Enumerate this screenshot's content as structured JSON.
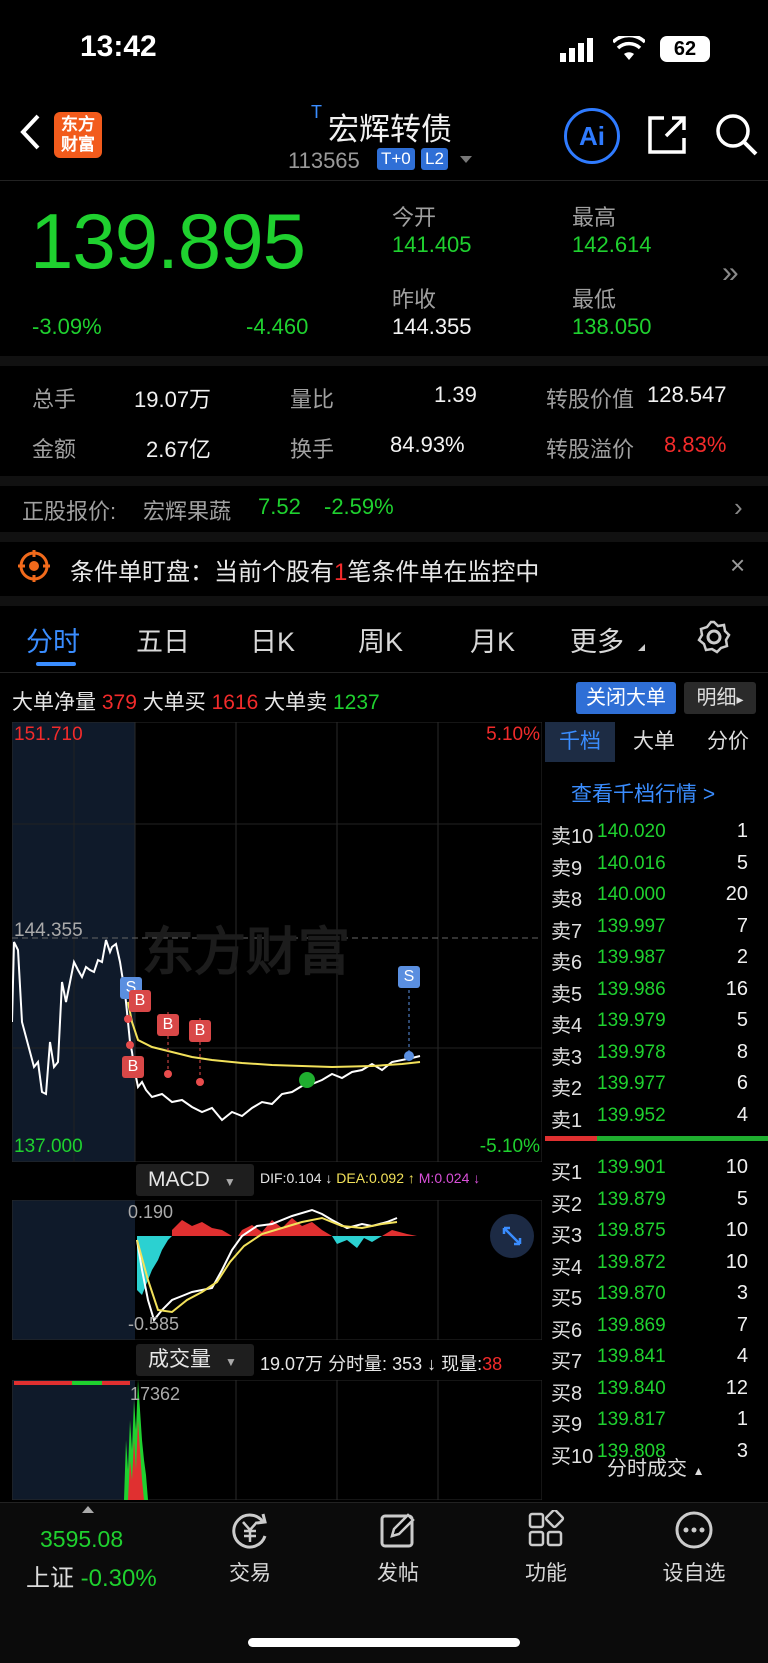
{
  "status_bar": {
    "time": "13:42",
    "battery": "62"
  },
  "header": {
    "logo_text": "东方\n财富",
    "prefix_mark": "T",
    "title": "宏辉转债",
    "code": "113565",
    "badge_t0": "T+0",
    "badge_l2": "L2",
    "ai_label": "Ai"
  },
  "quote": {
    "price": "139.895",
    "change_pct": "-3.09%",
    "change": "-4.460",
    "open_label": "今开",
    "open": "141.405",
    "high_label": "最高",
    "high": "142.614",
    "prev_close_label": "昨收",
    "prev_close": "144.355",
    "low_label": "最低",
    "low": "138.050"
  },
  "stats": {
    "volume_label": "总手",
    "volume": "19.07万",
    "ratio_label": "量比",
    "ratio": "1.39",
    "conv_value_label": "转股价值",
    "conv_value": "128.547",
    "amount_label": "金额",
    "amount": "2.67亿",
    "turnover_label": "换手",
    "turnover": "84.93%",
    "premium_label": "转股溢价",
    "premium": "8.83%"
  },
  "underlying": {
    "label": "正股报价:",
    "name": "宏辉果蔬",
    "price": "7.52",
    "change": "-2.59%"
  },
  "alert": {
    "prefix": "条件单盯盘：当前个股有",
    "count": "1",
    "suffix": "笔条件单在监控中"
  },
  "tabs": [
    "分时",
    "五日",
    "日K",
    "周K",
    "月K",
    "更多"
  ],
  "big_orders": {
    "net_label": "大单净量",
    "net": "379",
    "buy_label": "大单买",
    "buy": "1616",
    "sell_label": "大单卖",
    "sell": "1237",
    "close_btn": "关闭大单",
    "detail_btn": "明细"
  },
  "chart": {
    "top_left": "151.710",
    "top_right": "5.10%",
    "prev_close_line": "144.355",
    "bottom_left": "137.000",
    "bottom_right": "-5.10%",
    "watermark": "东方财富",
    "marker_b": "B",
    "marker_s": "S"
  },
  "macd": {
    "label": "MACD",
    "dif": "DIF:0.104 ↓",
    "dea": "DEA:0.092 ↑",
    "m": "M:0.024 ↓",
    "max": "0.190",
    "min": "-0.585"
  },
  "volume_panel": {
    "label": "成交量",
    "total": "19.07万",
    "minute": "分时量: 353 ↓",
    "now_label": "现量:",
    "now": "38",
    "max": "17362"
  },
  "orderbook": {
    "tabs": [
      "千档",
      "大单",
      "分价"
    ],
    "link": "查看千档行情 >",
    "asks": [
      {
        "label": "卖10",
        "price": "140.020",
        "vol": "1"
      },
      {
        "label": "卖9",
        "price": "140.016",
        "vol": "5"
      },
      {
        "label": "卖8",
        "price": "140.000",
        "vol": "20"
      },
      {
        "label": "卖7",
        "price": "139.997",
        "vol": "7"
      },
      {
        "label": "卖6",
        "price": "139.987",
        "vol": "2"
      },
      {
        "label": "卖5",
        "price": "139.986",
        "vol": "16"
      },
      {
        "label": "卖4",
        "price": "139.979",
        "vol": "5"
      },
      {
        "label": "卖3",
        "price": "139.978",
        "vol": "8"
      },
      {
        "label": "卖2",
        "price": "139.977",
        "vol": "6"
      },
      {
        "label": "卖1",
        "price": "139.952",
        "vol": "4"
      }
    ],
    "bids": [
      {
        "label": "买1",
        "price": "139.901",
        "vol": "10"
      },
      {
        "label": "买2",
        "price": "139.879",
        "vol": "5"
      },
      {
        "label": "买3",
        "price": "139.875",
        "vol": "10"
      },
      {
        "label": "买4",
        "price": "139.872",
        "vol": "10"
      },
      {
        "label": "买5",
        "price": "139.870",
        "vol": "3"
      },
      {
        "label": "买6",
        "price": "139.869",
        "vol": "7"
      },
      {
        "label": "买7",
        "price": "139.841",
        "vol": "4"
      },
      {
        "label": "买8",
        "price": "139.840",
        "vol": "12"
      },
      {
        "label": "买9",
        "price": "139.817",
        "vol": "1"
      },
      {
        "label": "买10",
        "price": "139.808",
        "vol": "3"
      }
    ],
    "footer": "分时成交"
  },
  "bottom_nav": {
    "index_value": "3595.08",
    "index_name": "上证",
    "index_change": "-0.30%",
    "items": [
      "交易",
      "发帖",
      "功能",
      "设自选"
    ]
  }
}
